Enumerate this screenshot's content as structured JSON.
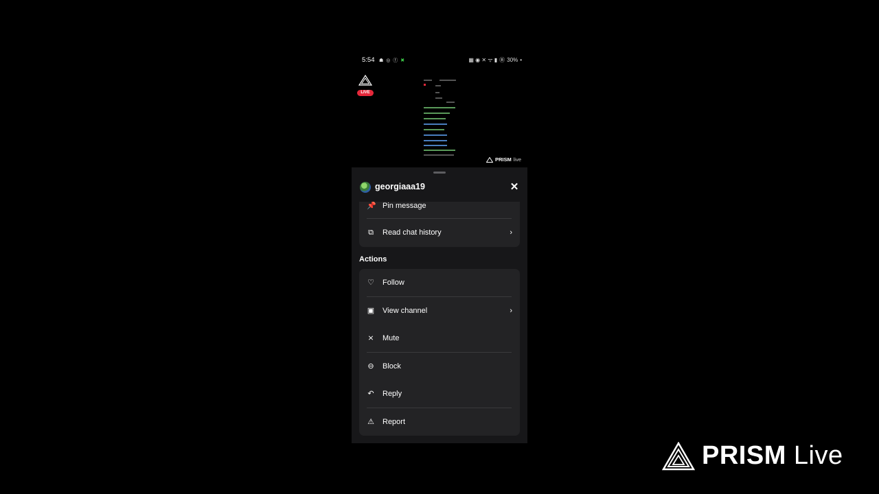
{
  "status_bar": {
    "time": "5:54",
    "notification_icons": "☗ ◎ ⓕ",
    "notif_extra": "✖",
    "right_icons": "▦ ◉ ✕ ᯤ ▮",
    "battery_icon": "Ⓑ",
    "battery": "30%",
    "dot": "•"
  },
  "live_badge": {
    "label": "LIVE"
  },
  "preview": {
    "watermark_brand": "PRISM",
    "watermark_suffix": "live"
  },
  "sheet": {
    "username": "georgiaaa19",
    "close_icon": "✕",
    "top_items": [
      {
        "label": "Pin message",
        "icon": "pin-icon",
        "glyph": "📌"
      },
      {
        "label": "Read chat history",
        "icon": "chat-history-icon",
        "glyph": "⧉",
        "chevron": "›"
      }
    ],
    "actions_title": "Actions",
    "actions": [
      {
        "label": "Follow",
        "icon": "heart-icon",
        "glyph": "♡"
      },
      {
        "label": "View channel",
        "icon": "channel-icon",
        "glyph": "▣",
        "chevron": "›"
      },
      {
        "label": "Mute",
        "icon": "mute-icon",
        "glyph": "⨯"
      },
      {
        "label": "Block",
        "icon": "block-icon",
        "glyph": "⊖"
      },
      {
        "label": "Reply",
        "icon": "reply-icon",
        "glyph": "↶"
      },
      {
        "label": "Report",
        "icon": "report-icon",
        "glyph": "⚠"
      }
    ]
  },
  "watermark": {
    "brand": "PRISM",
    "suffix": "Live"
  }
}
